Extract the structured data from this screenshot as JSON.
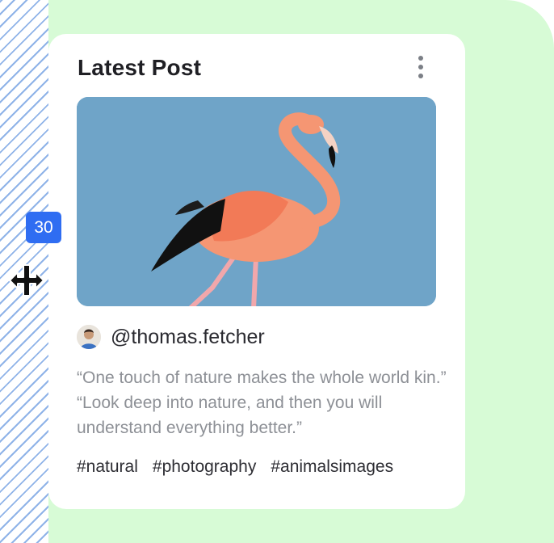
{
  "card": {
    "title": "Latest Post",
    "more_icon": "more-vertical-icon",
    "image_alt": "flamingo"
  },
  "author": {
    "handle": "@thomas.fetcher",
    "avatar_icon": "avatar"
  },
  "quote": "“One touch of nature makes the whole world kin.” “Look deep into nature, and then you will understand everything better.”",
  "tags": [
    "#natural",
    "#photography",
    "#animalsimages"
  ],
  "spacing_badge": {
    "value": "30"
  },
  "cursor_icon": "resize-horizontal-icon",
  "colors": {
    "page_bg": "#d7fbd6",
    "card_bg": "#ffffff",
    "accent": "#2f6df2",
    "sky": "#6fa4c8"
  }
}
